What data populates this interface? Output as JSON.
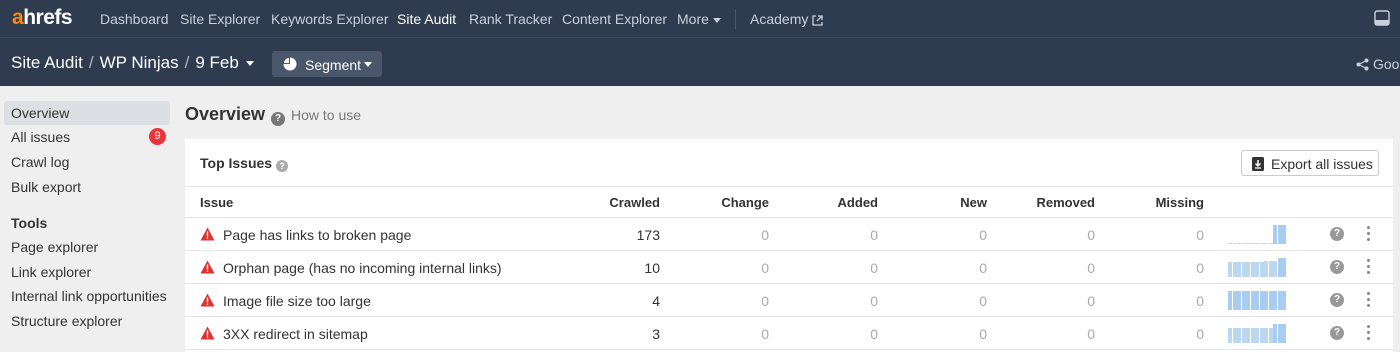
{
  "app": {
    "logo_prefix": "a",
    "logo_rest": "hrefs",
    "nav": [
      {
        "label": "Dashboard",
        "active": false
      },
      {
        "label": "Site Explorer",
        "active": false
      },
      {
        "label": "Keywords Explorer",
        "active": false
      },
      {
        "label": "Site Audit",
        "active": true
      },
      {
        "label": "Rank Tracker",
        "active": false
      },
      {
        "label": "Content Explorer",
        "active": false
      },
      {
        "label": "More",
        "active": false
      }
    ],
    "academy_label": "Academy",
    "window_icon": "window-icon",
    "colors": {
      "nav_bg": "#2f3c50",
      "brand_orange": "#ff8800",
      "badge_red": "#e8363a",
      "warn_red": "#e03131",
      "spark_blue": "#bcd8f0"
    }
  },
  "subheader": {
    "crumbs": [
      "Site Audit",
      "WP Ninjas",
      "9 Feb"
    ],
    "segment_label": "Segment",
    "share_label": "Goo"
  },
  "sidebar": {
    "items": [
      {
        "label": "Overview",
        "active": true
      },
      {
        "label": "All issues",
        "badge": "9"
      },
      {
        "label": "Crawl log"
      },
      {
        "label": "Bulk export"
      }
    ],
    "tools_title": "Tools",
    "tools": [
      {
        "label": "Page explorer"
      },
      {
        "label": "Link explorer"
      },
      {
        "label": "Internal link opportunities"
      },
      {
        "label": "Structure explorer"
      }
    ]
  },
  "main": {
    "title": "Overview",
    "how_to_use": "How to use",
    "top_issues": {
      "title": "Top Issues",
      "export_label": "Export all issues",
      "columns": [
        "Issue",
        "Crawled",
        "Change",
        "Added",
        "New",
        "Removed",
        "Missing"
      ],
      "rows": [
        {
          "issue": "Page has links to broken page",
          "crawled": "173",
          "change": "0",
          "added": "0",
          "new": "0",
          "removed": "0",
          "missing": "0",
          "trend": [
            0.05,
            0.05,
            0.05,
            0.05,
            0.05,
            0.05,
            0.05,
            0.05,
            0.05,
            0.05,
            1,
            1,
            1
          ]
        },
        {
          "issue": "Orphan page (has no incoming internal links)",
          "crawled": "10",
          "change": "0",
          "added": "0",
          "new": "0",
          "removed": "0",
          "missing": "0",
          "trend": [
            0.8,
            0.8,
            0.8,
            0.8,
            0.8,
            0.8,
            0.8,
            0.8,
            0.85,
            0.85,
            0.85,
            1,
            1
          ]
        },
        {
          "issue": "Image file size too large",
          "crawled": "4",
          "change": "0",
          "added": "0",
          "new": "0",
          "removed": "0",
          "missing": "0",
          "trend": [
            1,
            1,
            1,
            1,
            1,
            1,
            1,
            1,
            1,
            1,
            1,
            1,
            1
          ]
        },
        {
          "issue": "3XX redirect in sitemap",
          "crawled": "3",
          "change": "0",
          "added": "0",
          "new": "0",
          "removed": "0",
          "missing": "0",
          "trend": [
            0.8,
            0.8,
            0.8,
            0.8,
            0.8,
            0.8,
            0.8,
            0.8,
            0.8,
            0.8,
            1,
            1,
            1
          ]
        }
      ]
    }
  }
}
